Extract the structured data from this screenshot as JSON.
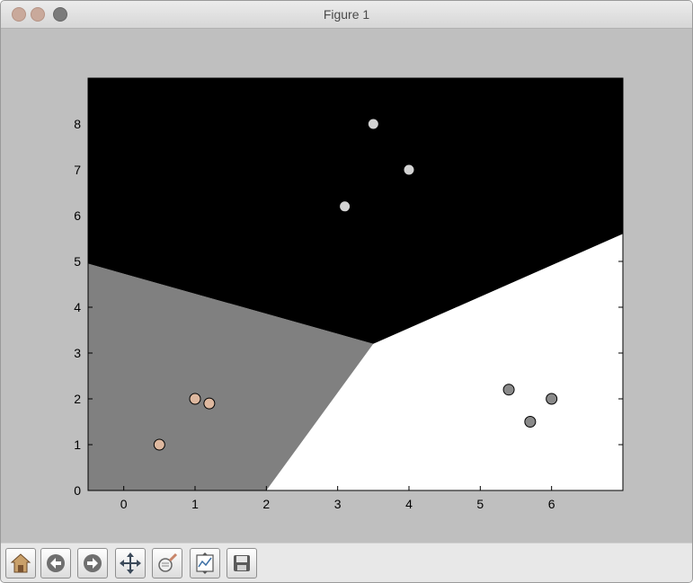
{
  "window": {
    "title": "Figure 1"
  },
  "toolbar": {
    "buttons": [
      {
        "name": "home-button",
        "icon": "home-icon"
      },
      {
        "name": "back-button",
        "icon": "back-arrow-icon"
      },
      {
        "name": "forward-button",
        "icon": "forward-arrow-icon"
      },
      {
        "name": "pan-button",
        "icon": "move-arrows-icon"
      },
      {
        "name": "zoom-button",
        "icon": "zoom-rectangle-icon"
      },
      {
        "name": "configure-subplots-button",
        "icon": "subplots-icon"
      },
      {
        "name": "save-button",
        "icon": "save-disk-icon"
      }
    ]
  },
  "chart_data": {
    "type": "scatter",
    "title": "",
    "xlabel": "",
    "ylabel": "",
    "xlim": [
      -0.5,
      7.0
    ],
    "ylim": [
      0,
      9
    ],
    "xticks": [
      "0",
      "1",
      "2",
      "3",
      "4",
      "5",
      "6"
    ],
    "yticks": [
      "0",
      "1",
      "2",
      "3",
      "4",
      "5",
      "6",
      "7",
      "8"
    ],
    "grid": false,
    "regions": [
      {
        "color": "#000000",
        "polygon": [
          [
            -0.5,
            9
          ],
          [
            7.0,
            9
          ],
          [
            7.0,
            5.6
          ],
          [
            3.5,
            3.2
          ],
          [
            -0.5,
            4.95
          ]
        ]
      },
      {
        "color": "#808080",
        "polygon": [
          [
            -0.5,
            0
          ],
          [
            2.0,
            0
          ],
          [
            3.5,
            3.2
          ],
          [
            -0.5,
            4.95
          ]
        ]
      },
      {
        "color": "#ffffff",
        "polygon": [
          [
            2.0,
            0
          ],
          [
            7.0,
            0
          ],
          [
            7.0,
            5.6
          ],
          [
            3.5,
            3.2
          ]
        ]
      }
    ],
    "series": [
      {
        "color": "#d3d3d3",
        "stroke": "#d3d3d3",
        "size": 5,
        "x": [
          3.5,
          4.0,
          3.1
        ],
        "y": [
          8.0,
          7.0,
          6.2
        ]
      },
      {
        "color": "#deb89f",
        "stroke": "#000000",
        "size": 6,
        "x": [
          0.5,
          1.0,
          1.2
        ],
        "y": [
          1.0,
          2.0,
          1.9
        ]
      },
      {
        "color": "#8a8a8a",
        "stroke": "#000000",
        "size": 6,
        "x": [
          5.4,
          5.7,
          6.0
        ],
        "y": [
          2.2,
          1.5,
          2.0
        ]
      }
    ]
  }
}
